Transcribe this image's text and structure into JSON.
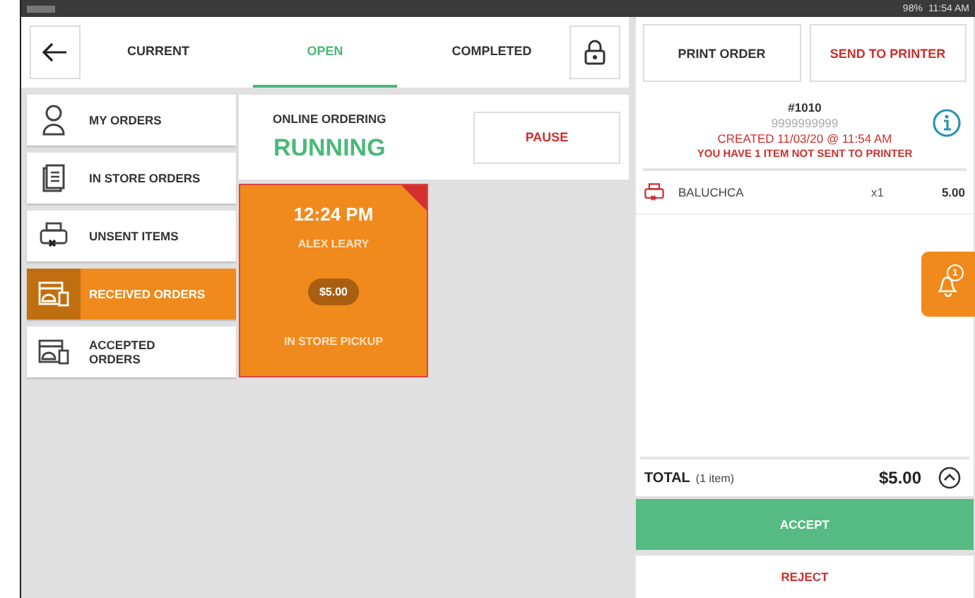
{
  "status_bar": {
    "battery": "98%",
    "time": "11:54 AM"
  },
  "tabs": [
    {
      "label": "CURRENT",
      "selected": false
    },
    {
      "label": "OPEN",
      "selected": true
    },
    {
      "label": "COMPLETED",
      "selected": false
    }
  ],
  "nav_items": [
    {
      "label": "MY ORDERS",
      "kind": "person",
      "selected": false
    },
    {
      "label": "IN STORE ORDERS",
      "kind": "document",
      "selected": false
    },
    {
      "label": "UNSENT ITEMS",
      "kind": "printer",
      "selected": false
    },
    {
      "label": "RECEIVED ORDERS",
      "kind": "tray",
      "selected": true
    },
    {
      "label": "ACCEPTED ORDERS",
      "kind": "tray",
      "selected": false
    }
  ],
  "online_ordering": {
    "label": "ONLINE ORDERING",
    "status": "RUNNING",
    "pause_button": "PAUSE"
  },
  "orders": [
    {
      "time": "12:24 PM",
      "customer": "ALEX LEARY",
      "total": "$5.00",
      "type": "IN STORE PICKUP",
      "flagged": true
    }
  ],
  "order_panel": {
    "print_button": "PRINT ORDER",
    "send_button": "SEND TO PRINTER",
    "number": "#1010",
    "phone": "9999999999",
    "created": "CREATED 11/03/20 @ 11:54 AM",
    "warning": "YOU HAVE 1 ITEM NOT SENT TO PRINTER",
    "items": [
      {
        "name": "BALUCHCA",
        "qty": "x1",
        "price": "5.00",
        "unsent": true
      }
    ],
    "total_label": "TOTAL",
    "total_count": "(1 item)",
    "total": "$5.00",
    "accept_button": "ACCEPT",
    "reject_button": "REJECT"
  },
  "notification": {
    "badge": "1"
  }
}
